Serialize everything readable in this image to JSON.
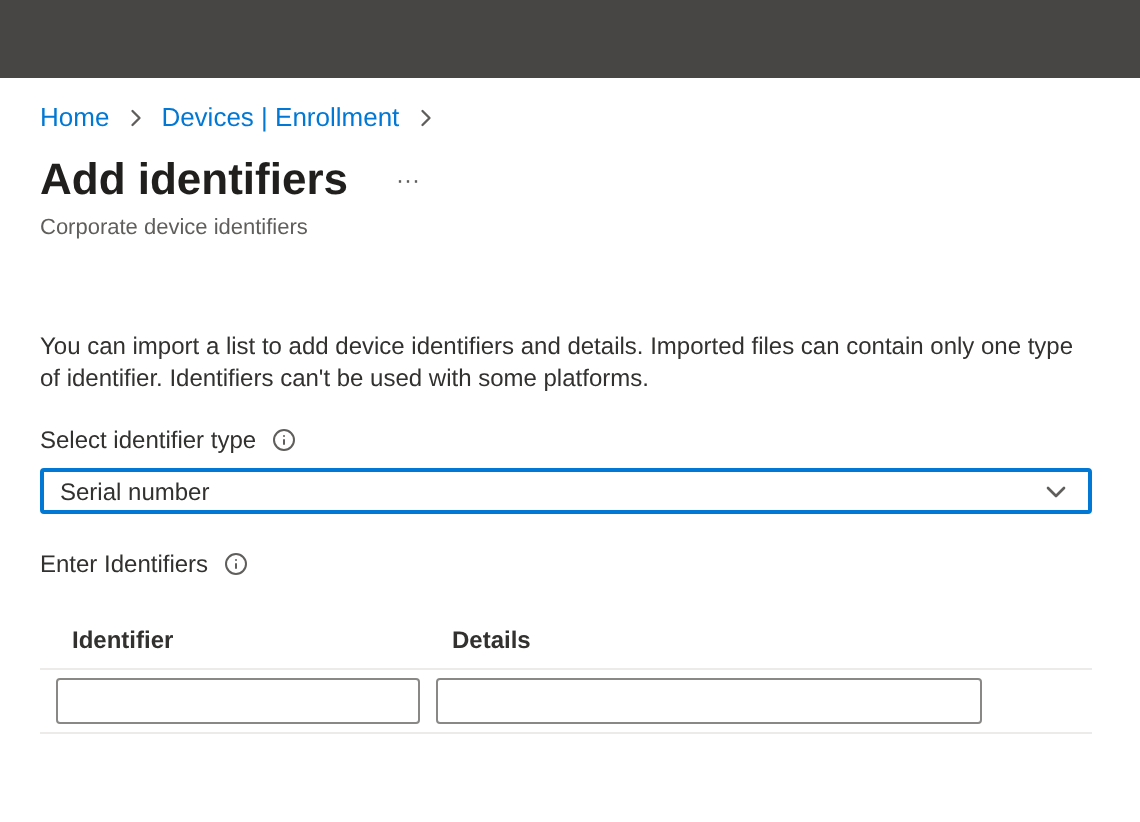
{
  "breadcrumb": [
    "Home",
    "Devices | Enrollment"
  ],
  "title": "Add identifiers",
  "more": "···",
  "subtitle": "Corporate device identifiers",
  "description": "You can import a list to add device identifiers and details. Imported files can contain only one type of identifier. Identifiers can't be used with some platforms.",
  "identifier_type": {
    "label": "Select identifier type",
    "value": "Serial number",
    "focused": true
  },
  "identifiers": {
    "label": "Enter Identifiers",
    "columns": [
      "Identifier",
      "Details"
    ]
  }
}
